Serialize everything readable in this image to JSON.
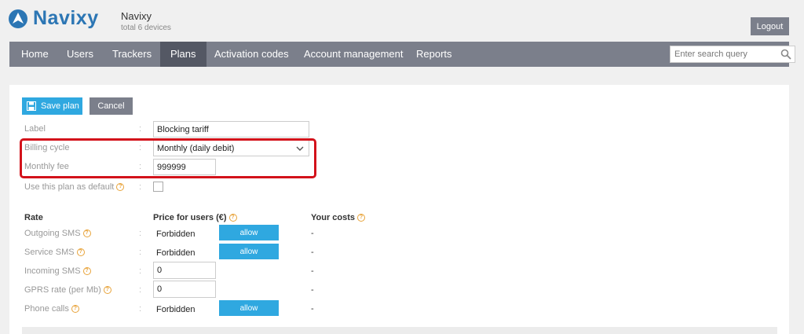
{
  "brand": {
    "name": "Navixy",
    "color": "#2c76b4"
  },
  "account": {
    "name": "Navixy",
    "subtitle": "total 6 devices"
  },
  "header": {
    "logout_label": "Logout"
  },
  "nav": {
    "items": [
      "Home",
      "Users",
      "Trackers",
      "Plans",
      "Activation codes",
      "Account management",
      "Reports"
    ],
    "active": "Plans"
  },
  "search": {
    "placeholder": "Enter search query",
    "icon": "magnifier-icon"
  },
  "toolbar": {
    "save_label": "Save plan",
    "cancel_label": "Cancel"
  },
  "form": {
    "label_label": "Label",
    "label_value": "Blocking tariff",
    "billing_cycle_label": "Billing cycle",
    "billing_cycle_value": "Monthly (daily debit)",
    "monthly_fee_label": "Monthly fee",
    "monthly_fee_value": "999999",
    "default_label": "Use this plan as default",
    "default_checked": false
  },
  "rates": {
    "headers": {
      "rate": "Rate",
      "price": "Price for users (€)",
      "costs": "Your costs"
    },
    "rows": [
      {
        "label": "Outgoing SMS",
        "type": "forbidden",
        "value": "Forbidden",
        "action": "allow",
        "cost": "-"
      },
      {
        "label": "Service SMS",
        "type": "forbidden",
        "value": "Forbidden",
        "action": "allow",
        "cost": "-"
      },
      {
        "label": "Incoming SMS",
        "type": "input",
        "value": "0",
        "cost": "-"
      },
      {
        "label": "GPRS rate (per Mb)",
        "type": "input",
        "value": "0",
        "cost": "-"
      },
      {
        "label": "Phone calls",
        "type": "forbidden",
        "value": "Forbidden",
        "action": "allow",
        "cost": "-"
      }
    ]
  },
  "colors": {
    "accent": "#2fa8e0",
    "nav_bg": "#7b7f8b",
    "nav_active": "#545864",
    "highlight": "#d3121b",
    "help": "#e8a33a"
  }
}
